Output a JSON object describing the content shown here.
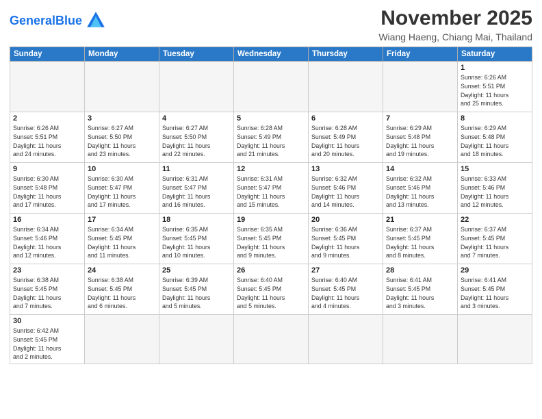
{
  "header": {
    "logo_general": "General",
    "logo_blue": "Blue",
    "month": "November 2025",
    "location": "Wiang Haeng, Chiang Mai, Thailand"
  },
  "weekdays": [
    "Sunday",
    "Monday",
    "Tuesday",
    "Wednesday",
    "Thursday",
    "Friday",
    "Saturday"
  ],
  "weeks": [
    [
      {
        "day": "",
        "info": ""
      },
      {
        "day": "",
        "info": ""
      },
      {
        "day": "",
        "info": ""
      },
      {
        "day": "",
        "info": ""
      },
      {
        "day": "",
        "info": ""
      },
      {
        "day": "",
        "info": ""
      },
      {
        "day": "1",
        "info": "Sunrise: 6:26 AM\nSunset: 5:51 PM\nDaylight: 11 hours\nand 25 minutes."
      }
    ],
    [
      {
        "day": "2",
        "info": "Sunrise: 6:26 AM\nSunset: 5:51 PM\nDaylight: 11 hours\nand 24 minutes."
      },
      {
        "day": "3",
        "info": "Sunrise: 6:27 AM\nSunset: 5:50 PM\nDaylight: 11 hours\nand 23 minutes."
      },
      {
        "day": "4",
        "info": "Sunrise: 6:27 AM\nSunset: 5:50 PM\nDaylight: 11 hours\nand 22 minutes."
      },
      {
        "day": "5",
        "info": "Sunrise: 6:28 AM\nSunset: 5:49 PM\nDaylight: 11 hours\nand 21 minutes."
      },
      {
        "day": "6",
        "info": "Sunrise: 6:28 AM\nSunset: 5:49 PM\nDaylight: 11 hours\nand 20 minutes."
      },
      {
        "day": "7",
        "info": "Sunrise: 6:29 AM\nSunset: 5:48 PM\nDaylight: 11 hours\nand 19 minutes."
      },
      {
        "day": "8",
        "info": "Sunrise: 6:29 AM\nSunset: 5:48 PM\nDaylight: 11 hours\nand 18 minutes."
      }
    ],
    [
      {
        "day": "9",
        "info": "Sunrise: 6:30 AM\nSunset: 5:48 PM\nDaylight: 11 hours\nand 17 minutes."
      },
      {
        "day": "10",
        "info": "Sunrise: 6:30 AM\nSunset: 5:47 PM\nDaylight: 11 hours\nand 17 minutes."
      },
      {
        "day": "11",
        "info": "Sunrise: 6:31 AM\nSunset: 5:47 PM\nDaylight: 11 hours\nand 16 minutes."
      },
      {
        "day": "12",
        "info": "Sunrise: 6:31 AM\nSunset: 5:47 PM\nDaylight: 11 hours\nand 15 minutes."
      },
      {
        "day": "13",
        "info": "Sunrise: 6:32 AM\nSunset: 5:46 PM\nDaylight: 11 hours\nand 14 minutes."
      },
      {
        "day": "14",
        "info": "Sunrise: 6:32 AM\nSunset: 5:46 PM\nDaylight: 11 hours\nand 13 minutes."
      },
      {
        "day": "15",
        "info": "Sunrise: 6:33 AM\nSunset: 5:46 PM\nDaylight: 11 hours\nand 12 minutes."
      }
    ],
    [
      {
        "day": "16",
        "info": "Sunrise: 6:34 AM\nSunset: 5:46 PM\nDaylight: 11 hours\nand 12 minutes."
      },
      {
        "day": "17",
        "info": "Sunrise: 6:34 AM\nSunset: 5:45 PM\nDaylight: 11 hours\nand 11 minutes."
      },
      {
        "day": "18",
        "info": "Sunrise: 6:35 AM\nSunset: 5:45 PM\nDaylight: 11 hours\nand 10 minutes."
      },
      {
        "day": "19",
        "info": "Sunrise: 6:35 AM\nSunset: 5:45 PM\nDaylight: 11 hours\nand 9 minutes."
      },
      {
        "day": "20",
        "info": "Sunrise: 6:36 AM\nSunset: 5:45 PM\nDaylight: 11 hours\nand 9 minutes."
      },
      {
        "day": "21",
        "info": "Sunrise: 6:37 AM\nSunset: 5:45 PM\nDaylight: 11 hours\nand 8 minutes."
      },
      {
        "day": "22",
        "info": "Sunrise: 6:37 AM\nSunset: 5:45 PM\nDaylight: 11 hours\nand 7 minutes."
      }
    ],
    [
      {
        "day": "23",
        "info": "Sunrise: 6:38 AM\nSunset: 5:45 PM\nDaylight: 11 hours\nand 7 minutes."
      },
      {
        "day": "24",
        "info": "Sunrise: 6:38 AM\nSunset: 5:45 PM\nDaylight: 11 hours\nand 6 minutes."
      },
      {
        "day": "25",
        "info": "Sunrise: 6:39 AM\nSunset: 5:45 PM\nDaylight: 11 hours\nand 5 minutes."
      },
      {
        "day": "26",
        "info": "Sunrise: 6:40 AM\nSunset: 5:45 PM\nDaylight: 11 hours\nand 5 minutes."
      },
      {
        "day": "27",
        "info": "Sunrise: 6:40 AM\nSunset: 5:45 PM\nDaylight: 11 hours\nand 4 minutes."
      },
      {
        "day": "28",
        "info": "Sunrise: 6:41 AM\nSunset: 5:45 PM\nDaylight: 11 hours\nand 3 minutes."
      },
      {
        "day": "29",
        "info": "Sunrise: 6:41 AM\nSunset: 5:45 PM\nDaylight: 11 hours\nand 3 minutes."
      }
    ],
    [
      {
        "day": "30",
        "info": "Sunrise: 6:42 AM\nSunset: 5:45 PM\nDaylight: 11 hours\nand 2 minutes."
      },
      {
        "day": "",
        "info": ""
      },
      {
        "day": "",
        "info": ""
      },
      {
        "day": "",
        "info": ""
      },
      {
        "day": "",
        "info": ""
      },
      {
        "day": "",
        "info": ""
      },
      {
        "day": "",
        "info": ""
      }
    ]
  ]
}
